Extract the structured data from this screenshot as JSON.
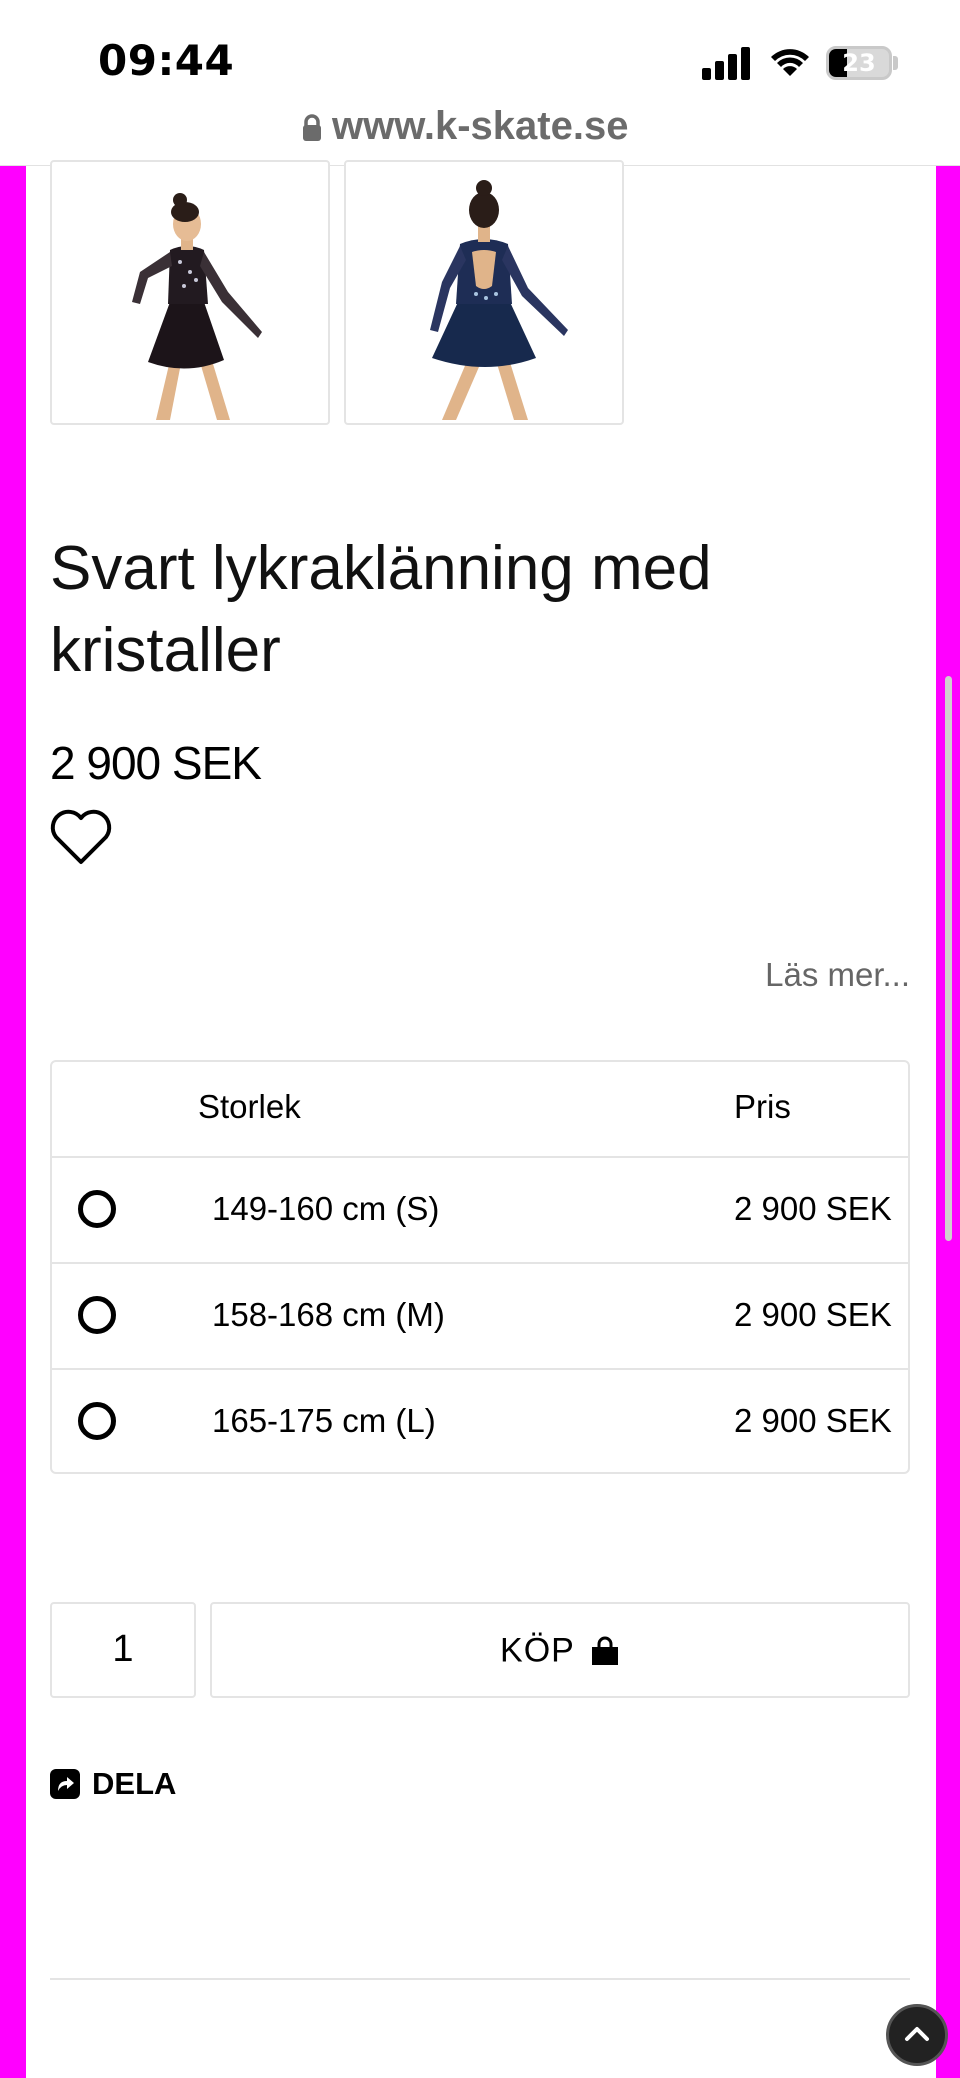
{
  "status_bar": {
    "time": "09:44",
    "battery_percent": "23"
  },
  "browser": {
    "url": "www.k-skate.se"
  },
  "product": {
    "title": "Svart lykraklänning med kristaller",
    "price": "2 900 SEK",
    "read_more": "Läs mer...",
    "images": [
      {
        "icon": "dress-front-image"
      },
      {
        "icon": "dress-back-image"
      }
    ]
  },
  "size_table": {
    "headers": {
      "size": "Storlek",
      "price": "Pris"
    },
    "rows": [
      {
        "size": "149-160 cm (S)",
        "price": "2 900 SEK"
      },
      {
        "size": "158-168 cm (M)",
        "price": "2 900 SEK"
      },
      {
        "size": "165-175 cm (L)",
        "price": "2 900 SEK"
      }
    ]
  },
  "purchase": {
    "quantity": "1",
    "buy_label": "KÖP",
    "share_label": "DELA"
  },
  "colors": {
    "frame": "#ff00ff",
    "text": "#000000",
    "muted": "#666666",
    "border": "#e4e4e4"
  }
}
